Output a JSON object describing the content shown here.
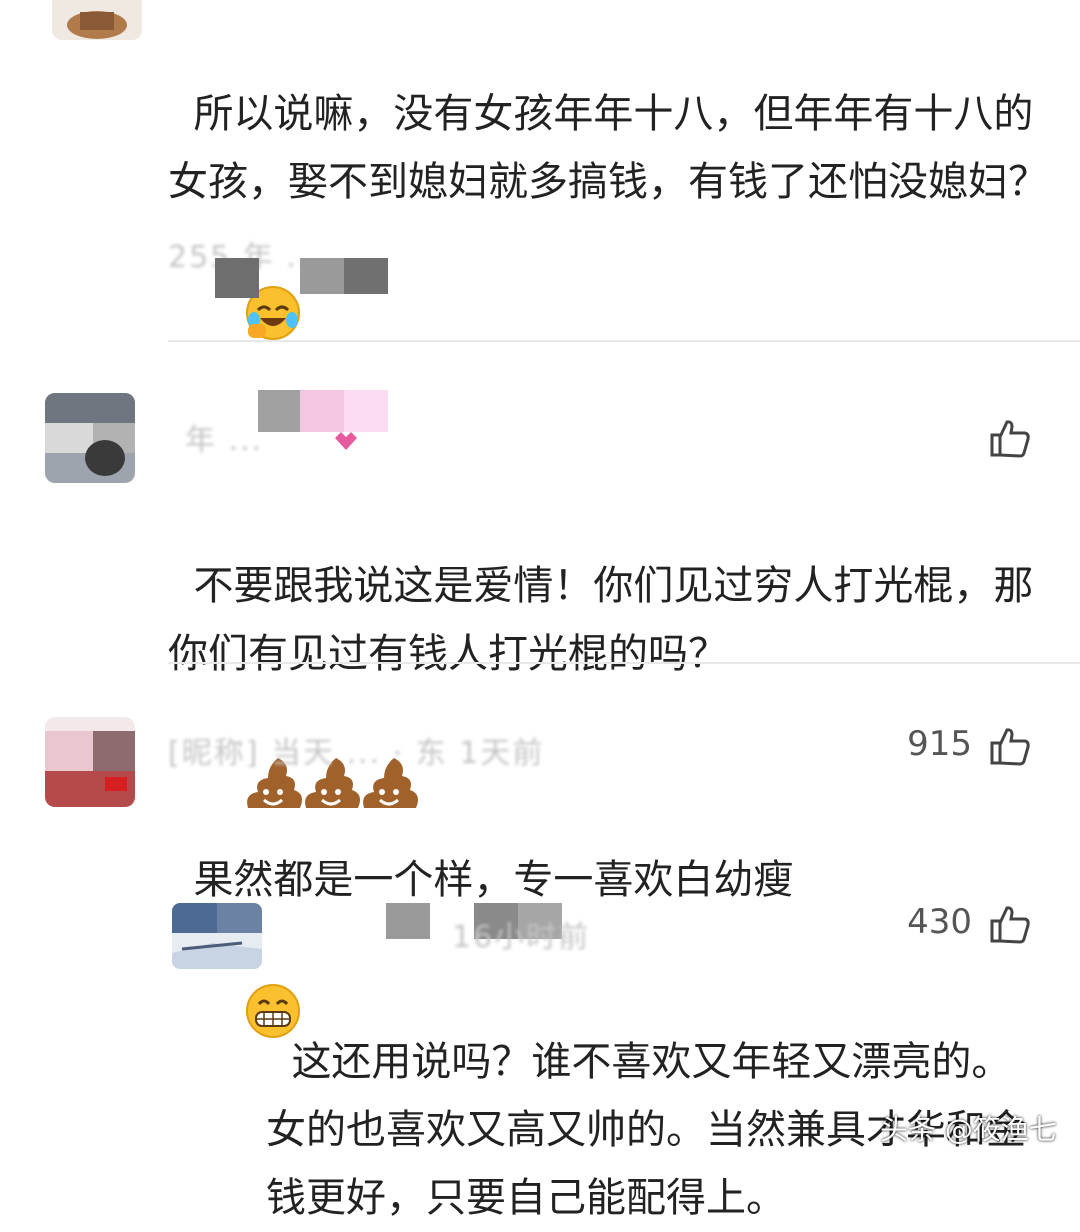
{
  "comments": [
    {
      "text": "所以说嘛，没有女孩年年十八，但年年有十八的女孩，娶不到媳妇就多搞钱，有钱了还怕没媳妇？",
      "emoji": "laugh-cry-emoji",
      "meta": "255 年 ..."
    },
    {
      "text": "不要跟我说这是爱情！你们见过穷人打光棍，那你们有见过有钱人打光棍的吗？",
      "emoji": "poop-emoji",
      "meta": "年  ...",
      "likes": ""
    },
    {
      "text": "果然都是一个样，专一喜欢白幼瘦",
      "emoji": "grin-emoji",
      "meta": "[昵称] 当天 ... · 东 1天前",
      "likes": "915"
    },
    {
      "text": "这还用说吗？谁不喜欢又年轻又漂亮的。女的也喜欢又高又帅的。当然兼具才华和金钱更好，只要自己能配得上。",
      "meta": "16小时前",
      "likes": "430"
    }
  ],
  "watermark": "头条 @筱渔七",
  "colors": {
    "divider": "#e8e8e8",
    "text": "#222222",
    "meta": "#c4c4c4"
  }
}
